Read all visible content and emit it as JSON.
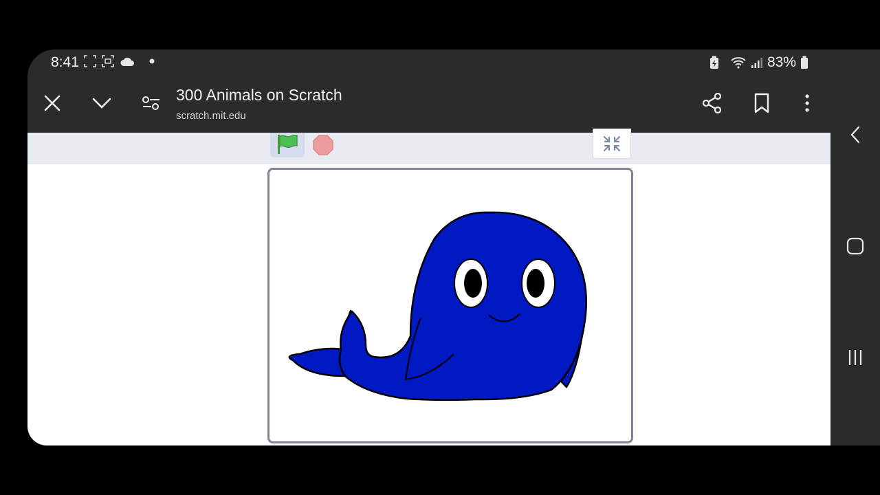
{
  "status_bar": {
    "time": "8:41",
    "battery": "83%"
  },
  "toolbar": {
    "title": "300 Animals on Scratch",
    "url": "scratch.mit.edu"
  },
  "icons": {
    "close": "close-icon",
    "collapse": "chevron-down-icon",
    "site_settings": "tune-icon",
    "share": "share-icon",
    "bookmark": "bookmark-icon",
    "menu": "more-vert-icon",
    "green_flag": "green-flag-icon",
    "stop": "stop-icon",
    "exit_fullscreen": "exit-fullscreen-icon",
    "nav_back": "back-icon",
    "nav_home": "home-icon",
    "nav_recents": "recents-icon"
  },
  "colors": {
    "toolbar_bg": "#2a2b2d",
    "whale_fill": "#0019c2",
    "flag_green": "#4cbf56",
    "stop_red": "#ec9c9c"
  }
}
